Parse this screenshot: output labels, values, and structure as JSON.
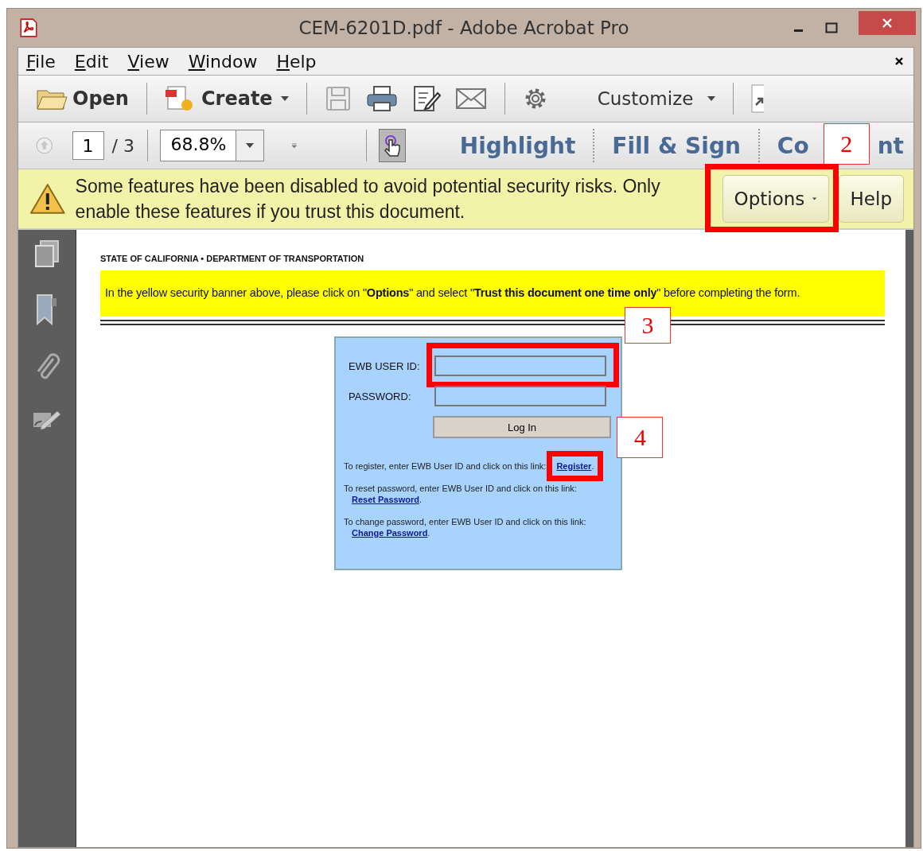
{
  "window": {
    "title": "CEM-6201D.pdf - Adobe Acrobat Pro"
  },
  "menu": [
    "File",
    "Edit",
    "View",
    "Window",
    "Help"
  ],
  "toolbar": {
    "open": "Open",
    "create": "Create",
    "customize": "Customize"
  },
  "nav": {
    "page": "1",
    "total": "/ 3",
    "zoom": "68.8%"
  },
  "tools": [
    {
      "text": "Highlight"
    },
    {
      "text": "Fill & Sign"
    },
    {
      "text": "Co",
      "rest": "nt"
    }
  ],
  "security_banner": {
    "message": "Some features have been disabled to avoid potential security risks. Only enable these features if you trust this document.",
    "buttons": [
      "Options",
      "Help"
    ]
  },
  "document": {
    "header": "STATE OF CALIFORNIA • DEPARTMENT OF TRANSPORTATION",
    "instruction": "In the yellow security banner above, please click on \"**Options**\" and select \"**Trust this document one time only**\" before completing the form.",
    "login": {
      "fields": [
        {
          "label": "EWB USER ID:"
        },
        {
          "label": "PASSWORD:"
        }
      ],
      "button": "Log In",
      "help": [
        {
          "text": "To register, enter EWB User ID and click on this link: ",
          "link": "Register",
          "end": "."
        },
        {
          "text": "To reset password, enter EWB User ID and click on this link: ",
          "link": "Reset Password",
          "end": "."
        },
        {
          "text": "To change password, enter EWB User ID and click on this link: ",
          "link": "Change Password",
          "end": "."
        }
      ]
    }
  },
  "callouts": [
    "2",
    "3",
    "4"
  ]
}
